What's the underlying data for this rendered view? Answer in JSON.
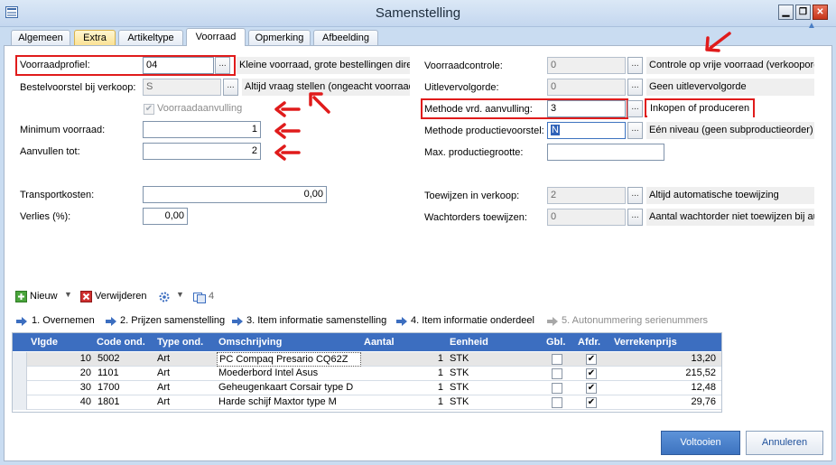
{
  "window": {
    "title": "Samenstelling",
    "buttons": {
      "minimize": "▁",
      "restore": "❐",
      "close": "✕"
    }
  },
  "tabs": [
    {
      "label": "Algemeen"
    },
    {
      "label": "Extra"
    },
    {
      "label": "Artikeltype"
    },
    {
      "label": "Voorraad"
    },
    {
      "label": "Opmerking"
    },
    {
      "label": "Afbeelding"
    }
  ],
  "form": {
    "voorraadprofiel": {
      "label": "Voorraadprofiel:",
      "value": "04",
      "desc": "Kleine voorraad, grote bestellingen dire"
    },
    "bestelvoorstel": {
      "label": "Bestelvoorstel bij verkoop:",
      "value": "S",
      "desc": "Altijd vraag stellen (ongeacht voorraad"
    },
    "voorraadaanvulling": {
      "label": "Voorraadaanvulling",
      "checked": "✔"
    },
    "minimum_voorraad": {
      "label": "Minimum voorraad:",
      "value": "1"
    },
    "aanvullen_tot": {
      "label": "Aanvullen tot:",
      "value": "2"
    },
    "transportkosten": {
      "label": "Transportkosten:",
      "value": "0,00"
    },
    "verlies": {
      "label": "Verlies (%):",
      "value": "0,00"
    },
    "voorraadcontrole": {
      "label": "Voorraadcontrole:",
      "value": "0",
      "desc": "Controle op vrije voorraad (verkoopord"
    },
    "uitlevervolgorde": {
      "label": "Uitlevervolgorde:",
      "value": "0",
      "desc": "Geen uitlevervolgorde"
    },
    "methode_aanvulling": {
      "label": "Methode vrd. aanvulling:",
      "value": "3",
      "desc": "Inkopen of produceren"
    },
    "methode_productievoorstel": {
      "label": "Methode productievoorstel:",
      "value": "N",
      "desc": "Eén niveau (geen subproductieorder)"
    },
    "max_productiegrootte": {
      "label": "Max. productiegrootte:",
      "value": ""
    },
    "toewijzen_verkoop": {
      "label": "Toewijzen in verkoop:",
      "value": "2",
      "desc": "Altijd automatische toewijzing"
    },
    "wachtorders": {
      "label": "Wachtorders toewijzen:",
      "value": "0",
      "desc": "Aantal wachtorder niet toewijzen bij au"
    },
    "lookup": "..."
  },
  "toolbar": {
    "new_label": "Nieuw",
    "delete_label": "Verwijderen",
    "count": "4"
  },
  "steps": [
    "1. Overnemen",
    "2. Prijzen samenstelling",
    "3. Item informatie samenstelling",
    "4. Item informatie onderdeel",
    "5. Autonummering serienummers"
  ],
  "grid": {
    "columns": [
      "Vlgde",
      "Code ond.",
      "Type ond.",
      "Omschrijving",
      "Aantal",
      "Eenheid",
      "Gbl.",
      "Afdr.",
      "Verrekenprijs"
    ],
    "rows": [
      {
        "vlgde": "10",
        "code": "5002",
        "type": "Art",
        "omschrijving": "PC Compaq Presario CQ62Z",
        "aantal": "1",
        "eenheid": "STK",
        "gbl": "",
        "afdr": "✔",
        "prijs": "13,20"
      },
      {
        "vlgde": "20",
        "code": "1101",
        "type": "Art",
        "omschrijving": "Moederbord Intel Asus",
        "aantal": "1",
        "eenheid": "STK",
        "gbl": "",
        "afdr": "✔",
        "prijs": "215,52"
      },
      {
        "vlgde": "30",
        "code": "1700",
        "type": "Art",
        "omschrijving": "Geheugenkaart Corsair type D",
        "aantal": "1",
        "eenheid": "STK",
        "gbl": "",
        "afdr": "✔",
        "prijs": "12,48"
      },
      {
        "vlgde": "40",
        "code": "1801",
        "type": "Art",
        "omschrijving": "Harde schijf Maxtor type M",
        "aantal": "1",
        "eenheid": "STK",
        "gbl": "",
        "afdr": "✔",
        "prijs": "29,76"
      }
    ]
  },
  "footer": {
    "ok_label": "Voltooien",
    "cancel_label": "Annuleren"
  },
  "colors": {
    "accent": "#3c6ec0",
    "highlight": "#e01b1b",
    "window_bg": "#c9dcf1"
  },
  "icons": [
    "app-icon",
    "minimize-icon",
    "restore-icon",
    "close-icon",
    "add-icon",
    "delete-icon",
    "settings-icon",
    "copy-icon",
    "arrow-right-icon",
    "checkbox-icon",
    "collapse-icon"
  ]
}
